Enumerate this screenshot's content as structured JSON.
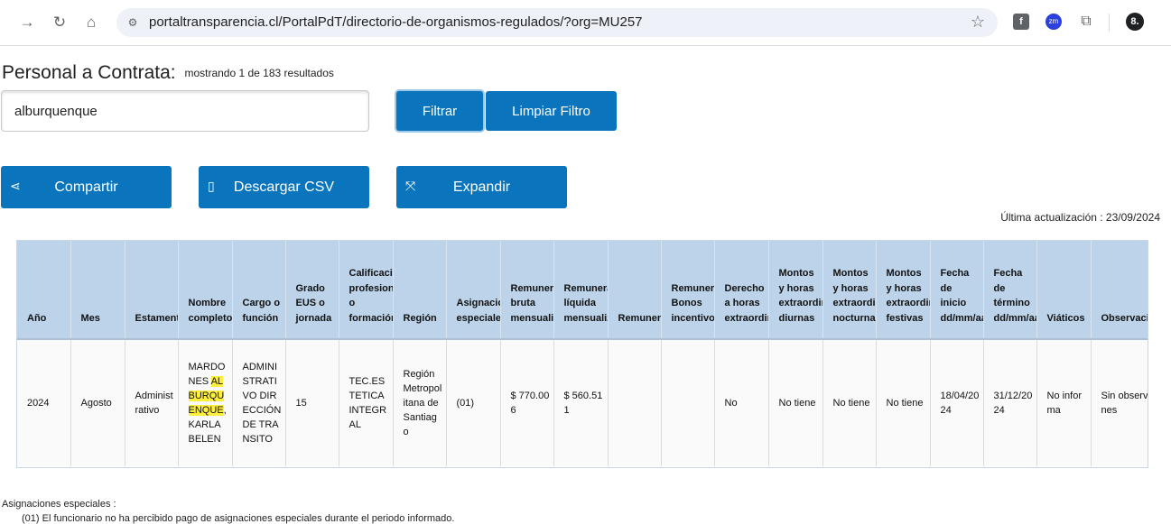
{
  "browser": {
    "url": "portaltransparencia.cl/PortalPdT/directorio-de-organismos-regulados/?org=MU257",
    "profile_initial": "8."
  },
  "page": {
    "title": "Personal a Contrata:",
    "results_text": "mostrando 1 de 183 resultados",
    "search_value": "alburquenque",
    "buttons": {
      "filtrar": "Filtrar",
      "limpiar": "Limpiar Filtro",
      "compartir": "Compartir",
      "descargar": "Descargar CSV",
      "expandir": "Expandir"
    },
    "updated": "Última actualización : 23/09/2024"
  },
  "table": {
    "headers": [
      "Año",
      "Mes",
      "Estamento",
      "Nombre completo",
      "Cargo o función",
      "Grado EUS o jornada",
      "Calificación profesional o formación",
      "Región",
      "Asignaciones especiales",
      "Remuneración bruta mensualizada",
      "Remuneración líquida mensualizada",
      "Remuneraciones adicionales",
      "Remuneración Bonos incentivos",
      "Derecho a horas extraordinarias",
      "Montos y horas extraordinarias diurnas",
      "Montos y horas extraordinarias nocturnas",
      "Montos y horas extraordinarias festivas",
      "Fecha de inicio dd/mm/aa",
      "Fecha de término dd/mm/aa",
      "Viáticos",
      "Observaciones"
    ],
    "row": {
      "anio": "2024",
      "mes": "Agosto",
      "estamento": "Administrativo",
      "nombre_pre": "MARDONES ",
      "nombre_hl": "ALBURQUENQUE",
      "nombre_post": ", KARLA BELEN",
      "cargo": "ADMINISTRATIVO DIRECCIÓN DE TRANSITO",
      "grado": "15",
      "calificacion": "TEC.ESTETICA INTEGRAL",
      "region": "Región Metropolitana de Santiago",
      "asignaciones": "(01)",
      "bruta": "$ 770.006",
      "liquida": "$ 560.511",
      "adicionales": "",
      "bonos": "",
      "derecho_horas": "No",
      "diurnas": "No tiene",
      "nocturnas": "No tiene",
      "festivas": "No tiene",
      "inicio": "18/04/2024",
      "termino": "31/12/2024",
      "viaticos": "No informa",
      "observaciones": "Sin observaciones"
    }
  },
  "footnotes": {
    "title": "Asignaciones especiales :",
    "item": "(01) El funcionario no ha percibido pago de asignaciones especiales durante el periodo informado."
  }
}
